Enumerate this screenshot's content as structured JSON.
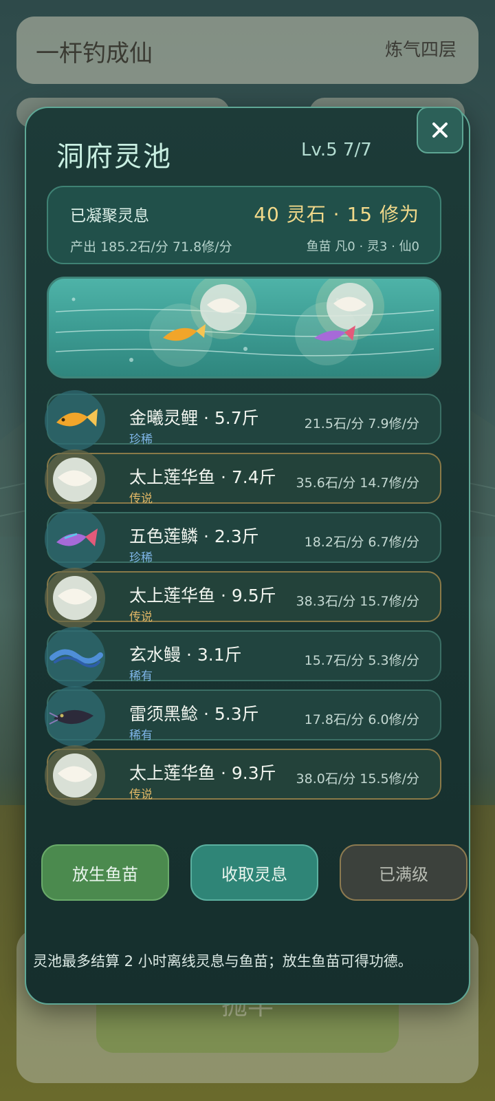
{
  "app": {
    "title": "一杆钓成仙",
    "realm": "炼气四层",
    "cast_label": "抛竿"
  },
  "modal": {
    "title": "洞府灵池",
    "level": "Lv.5  7/7",
    "close_icon": "close-icon",
    "summary": {
      "label": "已凝聚灵息",
      "value": "40 灵石 · 15 修为",
      "output": "产出 185.2石/分  71.8修/分",
      "fry": "鱼苗 凡0 · 灵3 · 仙0"
    },
    "fish": [
      {
        "name": "金曦灵鲤 · 5.7斤",
        "rarity": "珍稀",
        "rate": "21.5石/分 7.9修/分",
        "icon": "golden-carp-icon",
        "legend": false
      },
      {
        "name": "太上莲华鱼 · 7.4斤",
        "rarity": "传说",
        "rate": "35.6石/分 14.7修/分",
        "icon": "lotus-fish-icon",
        "legend": true
      },
      {
        "name": "五色莲鳞 · 2.3斤",
        "rarity": "珍稀",
        "rate": "18.2石/分 6.7修/分",
        "icon": "rainbow-fish-icon",
        "legend": false
      },
      {
        "name": "太上莲华鱼 · 9.5斤",
        "rarity": "传说",
        "rate": "38.3石/分 15.7修/分",
        "icon": "lotus-fish-icon",
        "legend": true
      },
      {
        "name": "玄水鳗 · 3.1斤",
        "rarity": "稀有",
        "rate": "15.7石/分 5.3修/分",
        "icon": "eel-icon",
        "legend": false
      },
      {
        "name": "雷须黑鲶 · 5.3斤",
        "rarity": "稀有",
        "rate": "17.8石/分 6.0修/分",
        "icon": "catfish-icon",
        "legend": false
      },
      {
        "name": "太上莲华鱼 · 9.3斤",
        "rarity": "传说",
        "rate": "38.0石/分 15.5修/分",
        "icon": "lotus-fish-icon",
        "legend": true
      }
    ],
    "buttons": {
      "release": "放生鱼苗",
      "collect": "收取灵息",
      "maxed": "已满级"
    },
    "note": "灵池最多结算 2 小时离线灵息与鱼苗；放生鱼苗可得功德。"
  },
  "colors": {
    "rare_blue": "#7fb6e8",
    "legend_gold": "#e0b766",
    "precious_blue": "#7fb6e8"
  }
}
